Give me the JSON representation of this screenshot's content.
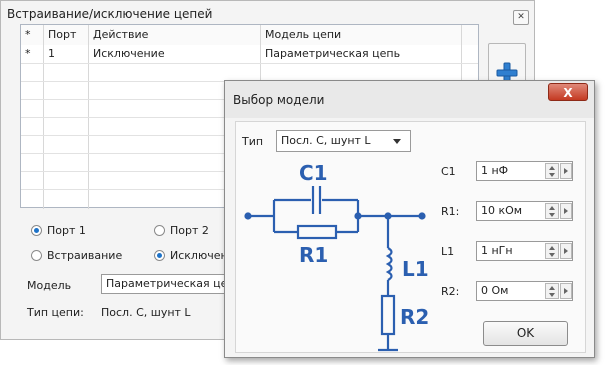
{
  "bg_window": {
    "title": "Встраивание/исключение цепей",
    "close_glyph": "✕",
    "table": {
      "headers": [
        "*",
        "Порт",
        "Действие",
        "Модель цепи"
      ],
      "rows": [
        [
          "*",
          "1",
          "Исключение",
          "Параметрическая цепь"
        ]
      ]
    },
    "add_icon": "plus-icon",
    "radio_port1": "Порт 1",
    "radio_port2": "Порт 2",
    "radio_embed": "Встраивание",
    "radio_exclude": "Исключение",
    "model_label": "Модель",
    "model_value": "Параметрическая цепь",
    "circuit_type_label": "Тип цепи:",
    "circuit_type_value": "Посл. C, шунт L"
  },
  "dialog": {
    "title": "Выбор модели",
    "close_glyph": "X",
    "type_label": "Тип",
    "type_value": "Посл. C, шунт L",
    "schematic": {
      "c1": "C1",
      "r1": "R1",
      "l1": "L1",
      "r2": "R2"
    },
    "params": [
      {
        "label": "C1",
        "value": "1 нФ"
      },
      {
        "label": "R1:",
        "value": "10 кОм"
      },
      {
        "label": "L1",
        "value": "1 нГн"
      },
      {
        "label": "R2:",
        "value": "0 Ом"
      }
    ],
    "ok_label": "OK"
  },
  "colors": {
    "schematic_blue": "#2b5fb0",
    "accent": "#1e73c8"
  }
}
